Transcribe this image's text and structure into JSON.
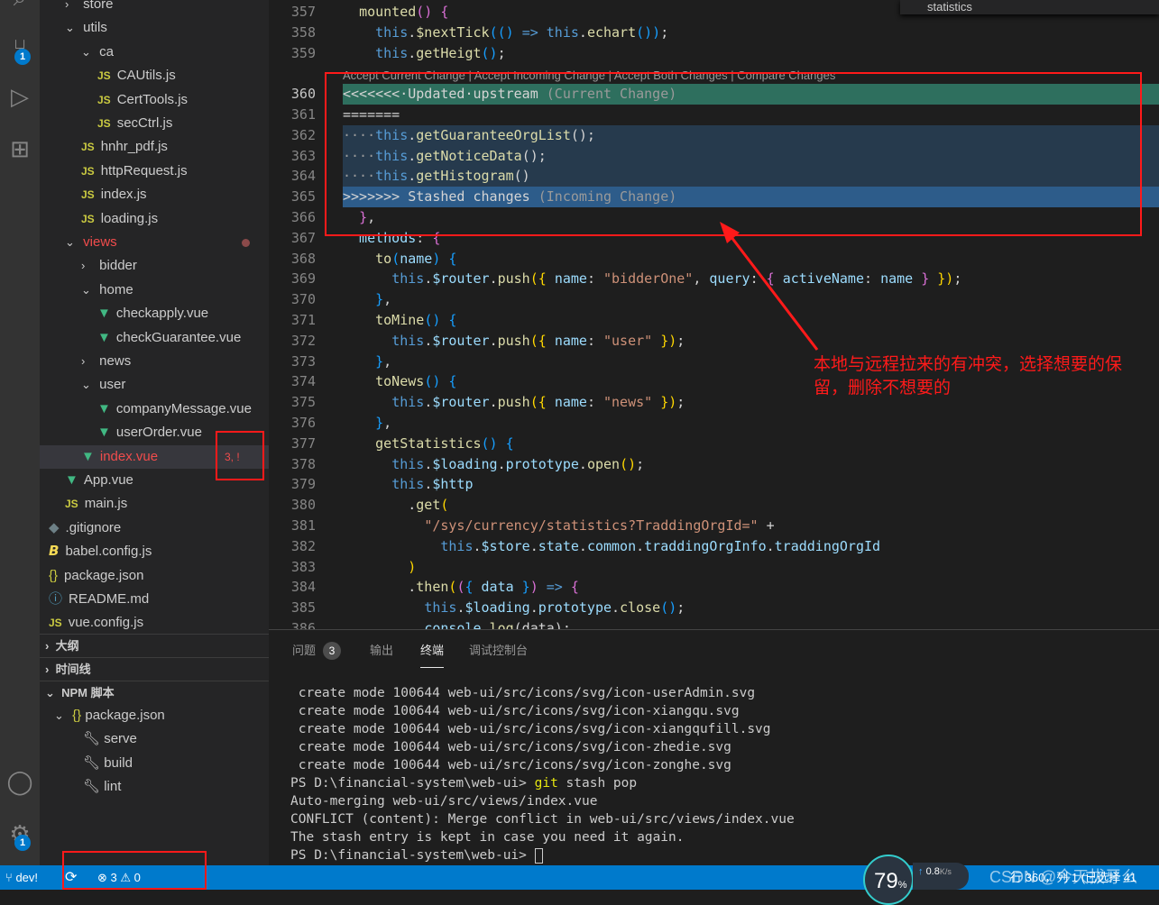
{
  "activity": {
    "scm_badge": "1",
    "settings_badge": "1"
  },
  "sidebar": {
    "tree": [
      {
        "label": "store",
        "kind": "folder",
        "open": false,
        "indent": 1
      },
      {
        "label": "utils",
        "kind": "folder",
        "open": true,
        "indent": 1
      },
      {
        "label": "ca",
        "kind": "folder",
        "open": true,
        "indent": 2
      },
      {
        "label": "CAUtils.js",
        "kind": "js",
        "indent": 3
      },
      {
        "label": "CertTools.js",
        "kind": "js",
        "indent": 3
      },
      {
        "label": "secCtrl.js",
        "kind": "js",
        "indent": 3
      },
      {
        "label": "hnhr_pdf.js",
        "kind": "js",
        "indent": 2
      },
      {
        "label": "httpRequest.js",
        "kind": "js",
        "indent": 2
      },
      {
        "label": "index.js",
        "kind": "js",
        "indent": 2
      },
      {
        "label": "loading.js",
        "kind": "js",
        "indent": 2
      },
      {
        "label": "views",
        "kind": "folder",
        "open": true,
        "indent": 1,
        "modified": true
      },
      {
        "label": "bidder",
        "kind": "folder",
        "open": false,
        "indent": 2
      },
      {
        "label": "home",
        "kind": "folder",
        "open": true,
        "indent": 2
      },
      {
        "label": "checkapply.vue",
        "kind": "vue",
        "indent": 3
      },
      {
        "label": "checkGuarantee.vue",
        "kind": "vue",
        "indent": 3
      },
      {
        "label": "news",
        "kind": "folder",
        "open": false,
        "indent": 2
      },
      {
        "label": "user",
        "kind": "folder",
        "open": true,
        "indent": 2
      },
      {
        "label": "companyMessage.vue",
        "kind": "vue",
        "indent": 3
      },
      {
        "label": "userOrder.vue",
        "kind": "vue",
        "indent": 3
      },
      {
        "label": "index.vue",
        "kind": "vue",
        "indent": 2,
        "conflict": true,
        "status": "3, !"
      },
      {
        "label": "App.vue",
        "kind": "vue",
        "indent": 1
      },
      {
        "label": "main.js",
        "kind": "js",
        "indent": 1
      },
      {
        "label": ".gitignore",
        "kind": "git",
        "indent": 0
      },
      {
        "label": "babel.config.js",
        "kind": "babel",
        "indent": 0
      },
      {
        "label": "package.json",
        "kind": "json",
        "indent": 0
      },
      {
        "label": "README.md",
        "kind": "info",
        "indent": 0
      },
      {
        "label": "vue.config.js",
        "kind": "js",
        "indent": 0
      }
    ],
    "outline": "大纲",
    "timeline": "时间线",
    "npm": "NPM 脚本",
    "npm_pkg": "package.json",
    "scripts": [
      "serve",
      "build",
      "lint"
    ]
  },
  "editor": {
    "find_text": "statistics",
    "codelens": "Accept Current Change | Accept Incoming Change | Accept Both Changes | Compare Changes",
    "lines": [
      {
        "n": "357",
        "t": [
          [
            "  ",
            "d"
          ],
          [
            "mounted",
            "f"
          ],
          [
            "() ",
            "b2"
          ],
          [
            "{",
            "b2"
          ]
        ]
      },
      {
        "n": "358",
        "t": [
          [
            "    ",
            "d"
          ],
          [
            "this",
            "k"
          ],
          [
            ".",
            "d"
          ],
          [
            "$nextTick",
            "f"
          ],
          [
            "((",
            "b3"
          ],
          [
            ") ",
            "b3"
          ],
          [
            "=> ",
            "k"
          ],
          [
            "this",
            "k"
          ],
          [
            ".",
            "d"
          ],
          [
            "echart",
            "f"
          ],
          [
            "())",
            "b3"
          ],
          [
            ";",
            "d"
          ]
        ]
      },
      {
        "n": "359",
        "t": [
          [
            "    ",
            "d"
          ],
          [
            "this",
            "k"
          ],
          [
            ".",
            "d"
          ],
          [
            "getHeigt",
            "f"
          ],
          [
            "()",
            "b3"
          ],
          [
            ";",
            "d"
          ]
        ]
      },
      {
        "n": "360",
        "t": [
          [
            "<<<<<<<·Updated·upstream ",
            "d"
          ],
          [
            "(Current Change)",
            "c"
          ]
        ],
        "bg": "cur"
      },
      {
        "n": "361",
        "t": [
          [
            "=======",
            "d"
          ]
        ],
        "bg": "sep"
      },
      {
        "n": "362",
        "t": [
          [
            "····",
            "c"
          ],
          [
            "this",
            "k"
          ],
          [
            ".",
            "d"
          ],
          [
            "getGuaranteeOrgList",
            "f"
          ],
          [
            "();",
            "d"
          ]
        ],
        "bg": "inc"
      },
      {
        "n": "363",
        "t": [
          [
            "····",
            "c"
          ],
          [
            "this",
            "k"
          ],
          [
            ".",
            "d"
          ],
          [
            "getNoticeData",
            "f"
          ],
          [
            "();",
            "d"
          ]
        ],
        "bg": "inc"
      },
      {
        "n": "364",
        "t": [
          [
            "····",
            "c"
          ],
          [
            "this",
            "k"
          ],
          [
            ".",
            "d"
          ],
          [
            "getHistogram",
            "f"
          ],
          [
            "()",
            "d"
          ]
        ],
        "bg": "inc"
      },
      {
        "n": "365",
        "t": [
          [
            ">>>>>>> Stashed changes ",
            "d"
          ],
          [
            "(Incoming Change)",
            "c"
          ]
        ],
        "bg": "inchead"
      },
      {
        "n": "366",
        "t": [
          [
            "  ",
            "d"
          ],
          [
            "}",
            "b2"
          ],
          [
            ",",
            "d"
          ]
        ]
      },
      {
        "n": "367",
        "t": [
          [
            "  methods",
            "p"
          ],
          [
            ": ",
            "d"
          ],
          [
            "{",
            "b2"
          ]
        ]
      },
      {
        "n": "368",
        "t": [
          [
            "    ",
            "d"
          ],
          [
            "to",
            "f"
          ],
          [
            "(",
            "b3"
          ],
          [
            "name",
            "p"
          ],
          [
            ") ",
            "b3"
          ],
          [
            "{",
            "b3"
          ]
        ]
      },
      {
        "n": "369",
        "t": [
          [
            "      ",
            "d"
          ],
          [
            "this",
            "k"
          ],
          [
            ".",
            "d"
          ],
          [
            "$router",
            "p"
          ],
          [
            ".",
            "d"
          ],
          [
            "push",
            "f"
          ],
          [
            "({ ",
            "b1"
          ],
          [
            "name",
            "p"
          ],
          [
            ": ",
            "d"
          ],
          [
            "\"bidderOne\"",
            "s"
          ],
          [
            ", ",
            "d"
          ],
          [
            "query",
            "p"
          ],
          [
            ": ",
            "d"
          ],
          [
            "{ ",
            "b2"
          ],
          [
            "activeName",
            "p"
          ],
          [
            ": ",
            "d"
          ],
          [
            "name",
            "p"
          ],
          [
            " }",
            "b2"
          ],
          [
            " })",
            "b1"
          ],
          [
            ";",
            "d"
          ]
        ]
      },
      {
        "n": "370",
        "t": [
          [
            "    ",
            "d"
          ],
          [
            "}",
            "b3"
          ],
          [
            ",",
            "d"
          ]
        ]
      },
      {
        "n": "371",
        "t": [
          [
            "    ",
            "d"
          ],
          [
            "toMine",
            "f"
          ],
          [
            "() ",
            "b3"
          ],
          [
            "{",
            "b3"
          ]
        ]
      },
      {
        "n": "372",
        "t": [
          [
            "      ",
            "d"
          ],
          [
            "this",
            "k"
          ],
          [
            ".",
            "d"
          ],
          [
            "$router",
            "p"
          ],
          [
            ".",
            "d"
          ],
          [
            "push",
            "f"
          ],
          [
            "({ ",
            "b1"
          ],
          [
            "name",
            "p"
          ],
          [
            ": ",
            "d"
          ],
          [
            "\"user\"",
            "s"
          ],
          [
            " })",
            "b1"
          ],
          [
            ";",
            "d"
          ]
        ]
      },
      {
        "n": "373",
        "t": [
          [
            "    ",
            "d"
          ],
          [
            "}",
            "b3"
          ],
          [
            ",",
            "d"
          ]
        ]
      },
      {
        "n": "374",
        "t": [
          [
            "    ",
            "d"
          ],
          [
            "toNews",
            "f"
          ],
          [
            "() ",
            "b3"
          ],
          [
            "{",
            "b3"
          ]
        ]
      },
      {
        "n": "375",
        "t": [
          [
            "      ",
            "d"
          ],
          [
            "this",
            "k"
          ],
          [
            ".",
            "d"
          ],
          [
            "$router",
            "p"
          ],
          [
            ".",
            "d"
          ],
          [
            "push",
            "f"
          ],
          [
            "({ ",
            "b1"
          ],
          [
            "name",
            "p"
          ],
          [
            ": ",
            "d"
          ],
          [
            "\"news\"",
            "s"
          ],
          [
            " })",
            "b1"
          ],
          [
            ";",
            "d"
          ]
        ]
      },
      {
        "n": "376",
        "t": [
          [
            "    ",
            "d"
          ],
          [
            "}",
            "b3"
          ],
          [
            ",",
            "d"
          ]
        ]
      },
      {
        "n": "377",
        "t": [
          [
            "    ",
            "d"
          ],
          [
            "getStatistics",
            "f"
          ],
          [
            "() ",
            "b3"
          ],
          [
            "{",
            "b3"
          ]
        ]
      },
      {
        "n": "378",
        "t": [
          [
            "      ",
            "d"
          ],
          [
            "this",
            "k"
          ],
          [
            ".",
            "d"
          ],
          [
            "$loading",
            "p"
          ],
          [
            ".",
            "d"
          ],
          [
            "prototype",
            "p"
          ],
          [
            ".",
            "d"
          ],
          [
            "open",
            "f"
          ],
          [
            "()",
            "b1"
          ],
          [
            ";",
            "d"
          ]
        ]
      },
      {
        "n": "379",
        "t": [
          [
            "      ",
            "d"
          ],
          [
            "this",
            "k"
          ],
          [
            ".",
            "d"
          ],
          [
            "$http",
            "p"
          ]
        ]
      },
      {
        "n": "380",
        "t": [
          [
            "        .",
            "d"
          ],
          [
            "get",
            "f"
          ],
          [
            "(",
            "b1"
          ]
        ]
      },
      {
        "n": "381",
        "t": [
          [
            "          ",
            "d"
          ],
          [
            "\"/sys/currency/statistics?TraddingOrgId=\"",
            "s"
          ],
          [
            " +",
            "d"
          ]
        ]
      },
      {
        "n": "382",
        "t": [
          [
            "            ",
            "d"
          ],
          [
            "this",
            "k"
          ],
          [
            ".",
            "d"
          ],
          [
            "$store",
            "p"
          ],
          [
            ".",
            "d"
          ],
          [
            "state",
            "p"
          ],
          [
            ".",
            "d"
          ],
          [
            "common",
            "p"
          ],
          [
            ".",
            "d"
          ],
          [
            "traddingOrgInfo",
            "p"
          ],
          [
            ".",
            "d"
          ],
          [
            "traddingOrgId",
            "p"
          ]
        ]
      },
      {
        "n": "383",
        "t": [
          [
            "        ",
            "d"
          ],
          [
            ")",
            "b1"
          ]
        ]
      },
      {
        "n": "384",
        "t": [
          [
            "        .",
            "d"
          ],
          [
            "then",
            "f"
          ],
          [
            "(",
            "b1"
          ],
          [
            "(",
            "b2"
          ],
          [
            "{ ",
            "b3"
          ],
          [
            "data",
            "p"
          ],
          [
            " }",
            "b3"
          ],
          [
            ") ",
            "b2"
          ],
          [
            "=> ",
            "k"
          ],
          [
            "{",
            "b2"
          ]
        ]
      },
      {
        "n": "385",
        "t": [
          [
            "          ",
            "d"
          ],
          [
            "this",
            "k"
          ],
          [
            ".",
            "d"
          ],
          [
            "$loading",
            "p"
          ],
          [
            ".",
            "d"
          ],
          [
            "prototype",
            "p"
          ],
          [
            ".",
            "d"
          ],
          [
            "close",
            "f"
          ],
          [
            "()",
            "b3"
          ],
          [
            ";",
            "d"
          ]
        ]
      },
      {
        "n": "386",
        "t": [
          [
            "          ",
            "d"
          ],
          [
            "console",
            "p"
          ],
          [
            ".",
            "d"
          ],
          [
            "log",
            "f"
          ],
          [
            "(data);",
            "d"
          ]
        ]
      }
    ]
  },
  "annotation": {
    "text": "本地与远程拉来的有冲突，选择想要的保留，删除不想要的",
    "color": "#ff1a1a"
  },
  "panel": {
    "tabs": [
      {
        "label": "问题",
        "badge": "3"
      },
      {
        "label": "输出"
      },
      {
        "label": "终端",
        "active": true
      },
      {
        "label": "调试控制台"
      }
    ],
    "terminal": [
      " create mode 100644 web-ui/src/icons/svg/icon-userAdmin.svg",
      " create mode 100644 web-ui/src/icons/svg/icon-xiangqu.svg",
      " create mode 100644 web-ui/src/icons/svg/icon-xiangqufill.svg",
      " create mode 100644 web-ui/src/icons/svg/icon-zhedie.svg",
      " create mode 100644 web-ui/src/icons/svg/icon-zonghe.svg",
      "PS D:\\financial-system\\web-ui> git stash pop",
      "Auto-merging web-ui/src/views/index.vue",
      "CONFLICT (content): Merge conflict in web-ui/src/views/index.vue",
      "The stash entry is kept in case you need it again.",
      "PS D:\\financial-system\\web-ui> "
    ]
  },
  "status": {
    "branch": "dev!",
    "errors": "3",
    "warnings": "0",
    "cursor": "行 360，列 1 (已选择 41",
    "watermark": "CSDN @今天拔牙么",
    "cpu": "79",
    "cpu_unit": "%",
    "net_speed": "0.8",
    "net_unit": "K/s"
  }
}
